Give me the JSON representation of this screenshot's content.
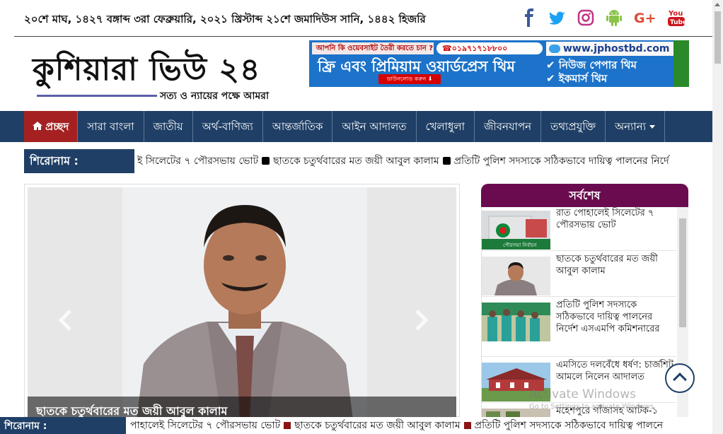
{
  "topbar": {
    "date": "২০শে মাঘ, ১৪২৭ বঙ্গাব্দ ৩রা ফেব্রুয়ারি, ২০২১ খ্রিস্টাব্দ ২১শে জমাদিউস সানি, ১৪৪২ হিজরি",
    "social": [
      "facebook-icon",
      "twitter-icon",
      "instagram-icon",
      "android-icon",
      "google-plus-icon",
      "youtube-icon"
    ],
    "social_colors": {
      "facebook": "#3b5998",
      "twitter": "#1da1f2",
      "instagram": "#c13584",
      "android": "#8bc34a",
      "google_plus": "#dd4b39",
      "youtube": "#cc181e"
    }
  },
  "logo": {
    "title": "কুশিয়ারা ভিউ ২৪",
    "tagline": "সত্য ও ন্যায়ের পক্ষে আমরা"
  },
  "ad": {
    "question": "আপনি কি ওয়েবসাইট তৈরী করতে চান ?",
    "phone": "☎০১৯৭১৭১৮৮০০",
    "headline": "ফ্রি এবং প্রিমিয়াম ওয়ার্ডপ্রেস থিম",
    "download": "ডাউনলোড করুন ⬇",
    "domain": "www.jphostbd.com",
    "feature1": "✔ নিউজ পেপার থিম",
    "feature2": "✔ ইকমার্স থিম"
  },
  "nav": {
    "items": [
      "প্রচ্ছদ",
      "সারা বাংলা",
      "জাতীয়",
      "অর্থ-বাণিজ্য",
      "আন্তর্জাতিক",
      "আইন আদালত",
      "খেলাধুলা",
      "জীবনযাপন",
      "তথ্যপ্রযুক্তি",
      "অন্যান্য"
    ]
  },
  "ticker_top": {
    "label": "শিরোনাম :",
    "item1": "ই সিলেটের ৭ পৌরসভায় ভোট",
    "item2": "ছাতকে চতুর্থবারের মত জয়ী আবুল কালাম",
    "item3": "প্রতিটি পুলিশ সদস্যকে সঠিকভাবে দায়িত্ব পালনের নির্দে"
  },
  "slider": {
    "caption": "ছাতকে চতুর্থবারের মত জয়ী আবুল কালাম"
  },
  "latest": {
    "heading": "সর্বশেষ",
    "items": [
      {
        "title": "রাত পোহালেই সিলেটের ৭ পৌরসভায় ভোট",
        "thumb_text": "পৌরসভা নির্বাচন"
      },
      {
        "title": "ছাতকে চতুর্থবারের মত জয়ী আবুল কালাম"
      },
      {
        "title": "প্রতিটি পুলিশ সদস্যকে সঠিকভাবে দায়িত্ব পালনের নির্দেশ এসএমপি কমিশনারের"
      },
      {
        "title": "এমসিতে দলবেঁধে ধর্ষণ: চার্জশিট আমলে নিলেন আদালত"
      },
      {
        "title": "মহেশপুরে গাঁজাসহ আটক-১"
      }
    ]
  },
  "watermark": {
    "line1": "Activate Windows",
    "line2": "Go to Settings to activate Windows."
  },
  "ticker_bottom": {
    "label": "শিরোনাম :",
    "item1": "পাহালেই সিলেটের ৭ পৌরসভায় ভোট",
    "item2": "ছাতকে চতুর্থবারের মত জয়ী আবুল কালাম",
    "item3": "প্রতিটি পুলিশ সদস্যকে সঠিকভাবে দায়িত্ব পালনে"
  }
}
